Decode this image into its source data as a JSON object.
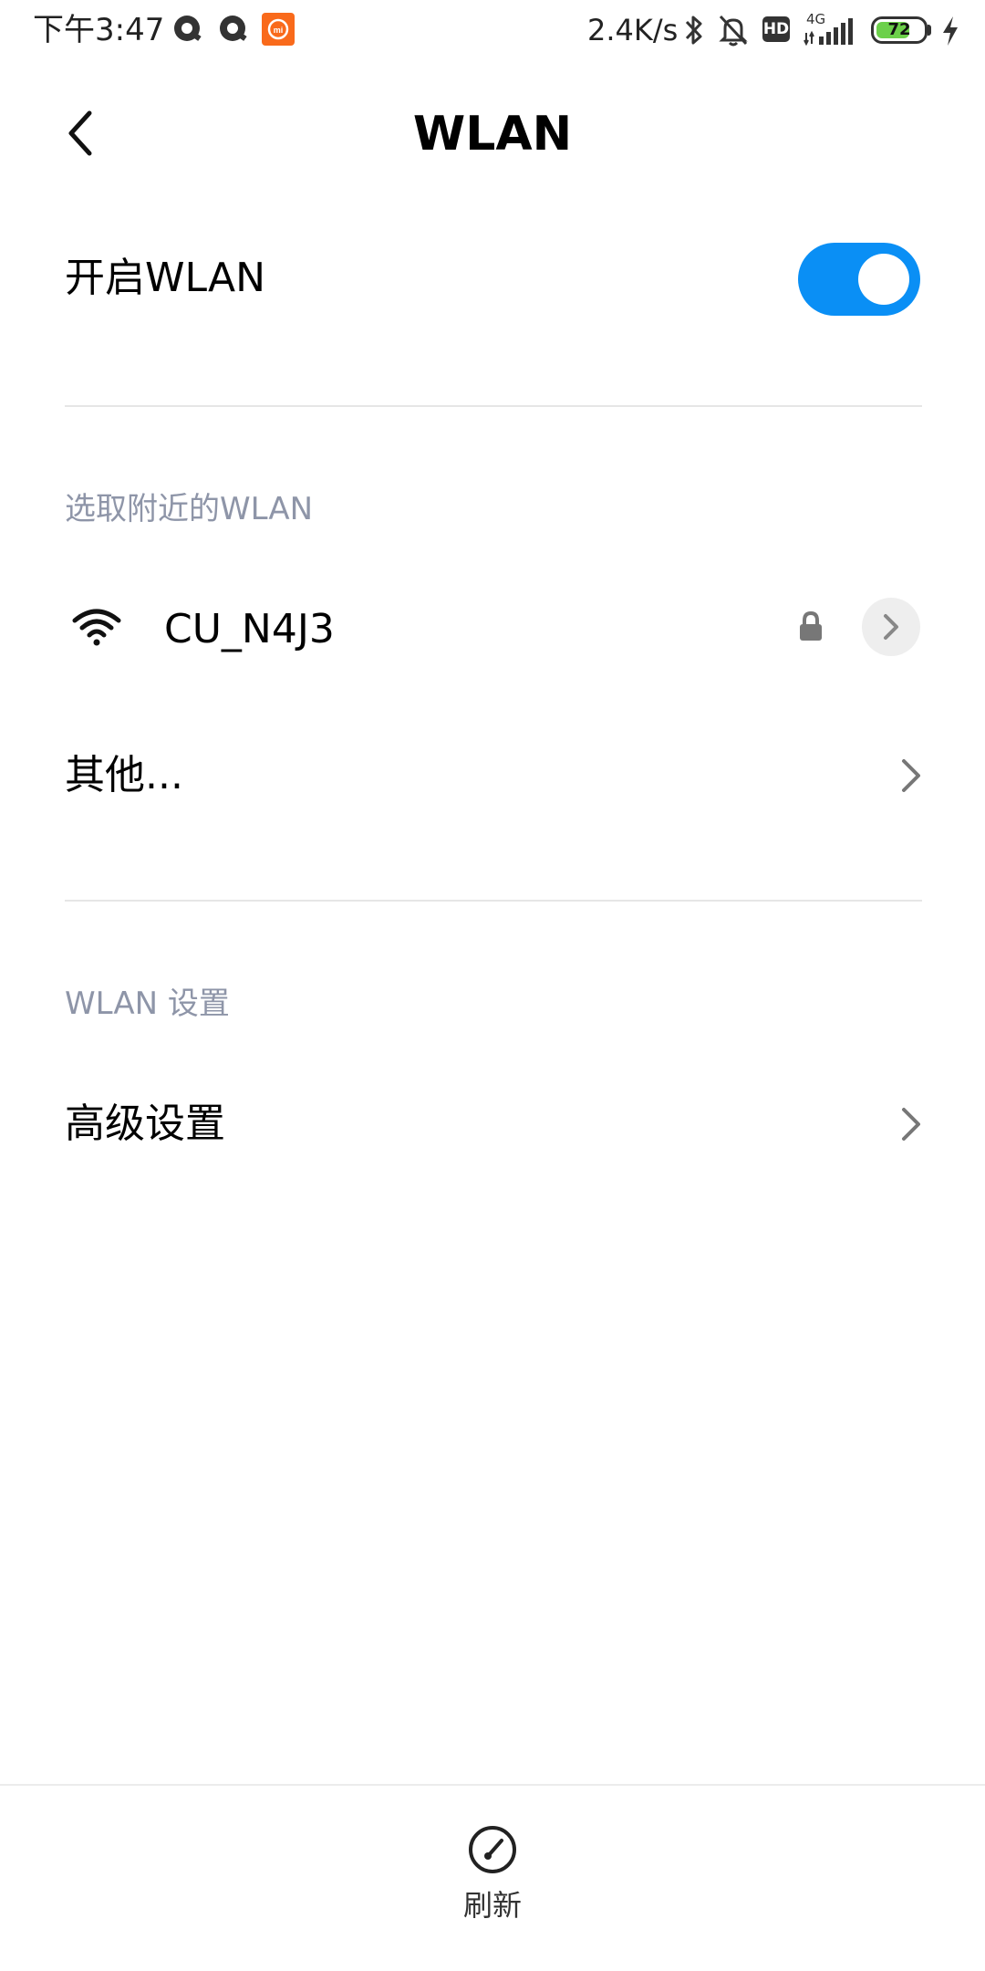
{
  "status_bar": {
    "time": "下午3:47",
    "net_speed": "2.4K/s",
    "hd_badge": "HD",
    "network_type": "4G",
    "battery_level": "72",
    "battery_fraction": 0.72,
    "icons": [
      "notification-q-icon",
      "notification-q-icon",
      "mi-app-icon",
      "bluetooth-icon",
      "mute-bell-icon",
      "hd-icon",
      "signal-icon",
      "battery-icon",
      "charging-icon"
    ]
  },
  "header": {
    "title": "WLAN"
  },
  "wlan_toggle": {
    "label": "开启WLAN",
    "enabled": true,
    "accent_color": "#0a8ff5"
  },
  "nearby": {
    "section_label": "选取附近的WLAN",
    "networks": [
      {
        "ssid": "CU_N4J3",
        "secured": true
      }
    ],
    "other_label": "其他..."
  },
  "settings": {
    "section_label": "WLAN 设置",
    "advanced_label": "高级设置"
  },
  "bottom_bar": {
    "refresh_label": "刷新"
  }
}
